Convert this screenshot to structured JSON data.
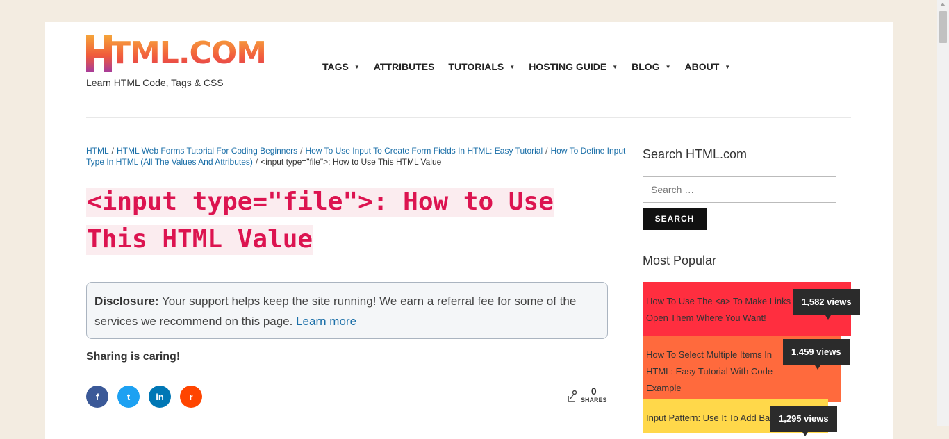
{
  "logo": {
    "text": "TML.COM",
    "letter": "H"
  },
  "tagline": "Learn HTML Code, Tags & CSS",
  "nav": [
    {
      "label": "TAGS",
      "caret": "▼"
    },
    {
      "label": "ATTRIBUTES",
      "caret": ""
    },
    {
      "label": "TUTORIALS",
      "caret": "▼"
    },
    {
      "label": "HOSTING GUIDE",
      "caret": "▼"
    },
    {
      "label": "BLOG",
      "caret": "▼"
    },
    {
      "label": "ABOUT",
      "caret": "▼"
    }
  ],
  "breadcrumb": {
    "items": [
      "HTML",
      "HTML Web Forms Tutorial For Coding Beginners",
      "How To Use Input To Create Form Fields In HTML: Easy Tutorial",
      "How To Define Input Type In HTML (All The Values And Attributes)"
    ],
    "separator": "/",
    "current": "<input type=\"file\">: How to Use This HTML Value"
  },
  "title": "<input type=\"file\">: How to Use This HTML Value",
  "disclosure": {
    "label": "Disclosure:",
    "text": " Your support helps keep the site running! We earn a referral fee for some of the services we recommend on this page. ",
    "link": "Learn more"
  },
  "sharing": {
    "heading": "Sharing is caring!",
    "count": "0",
    "count_label": "SHARES",
    "buttons": [
      {
        "name": "facebook",
        "glyph": "f",
        "color": "#3b5998"
      },
      {
        "name": "twitter",
        "glyph": "t",
        "color": "#1da1f2"
      },
      {
        "name": "linkedin",
        "glyph": "in",
        "color": "#0077b5"
      },
      {
        "name": "reddit",
        "glyph": "r",
        "color": "#ff4500"
      }
    ]
  },
  "sidebar": {
    "search_heading": "Search HTML.com",
    "search_placeholder": "Search …",
    "search_button": "SEARCH",
    "popular_heading": "Most Popular",
    "popular": [
      {
        "title": "How To Use The <a> To Make Links Open Them Where You Want!",
        "views": "1,582 views",
        "color": "#ff2e3f"
      },
      {
        "title": "How To Select Multiple Items In HTML: Easy Tutorial With Code Example",
        "views": "1,459 views",
        "color": "#ff6a3d"
      },
      {
        "title": "Input Pattern: Use It To Add Basic",
        "views": "1,295 views",
        "color": "#ffd84a"
      }
    ]
  }
}
